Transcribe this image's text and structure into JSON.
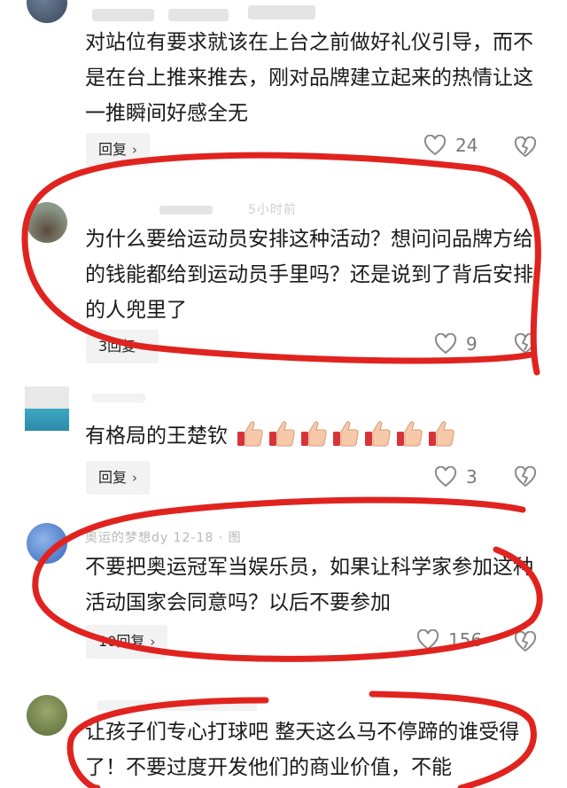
{
  "comments": [
    {
      "text": "对站位有要求就该在上台之前做好礼仪引导，而不是在台上推来推去，刚对品牌建立起来的热情让这一推瞬间好感全无",
      "reply_label": "回复",
      "like_count": "24"
    },
    {
      "meta": "5小时前",
      "text": "为什么要给运动员安排这种活动？想问问品牌方给的钱能都给到运动员手里吗？还是说到了背后安排的人兜里了",
      "reply_label": "3回复",
      "like_count": "9"
    },
    {
      "text": "有格局的王楚钦",
      "reply_label": "回复",
      "like_count": "3"
    },
    {
      "meta": "奥运的梦想dy  12-18  ·  图",
      "text": "不要把奥运冠军当娱乐员，如果让科学家参加这种活动国家会同意吗？以后不要参加",
      "reply_label": "10回复",
      "like_count": "156"
    },
    {
      "text": "让孩子们专心打球吧 整天这么马不停蹄的谁受得了！不要过度开发他们的商业价值，不能"
    }
  ],
  "colors": {
    "annotation_red": "#e0231f",
    "reply_bg": "#f2f2f2"
  }
}
